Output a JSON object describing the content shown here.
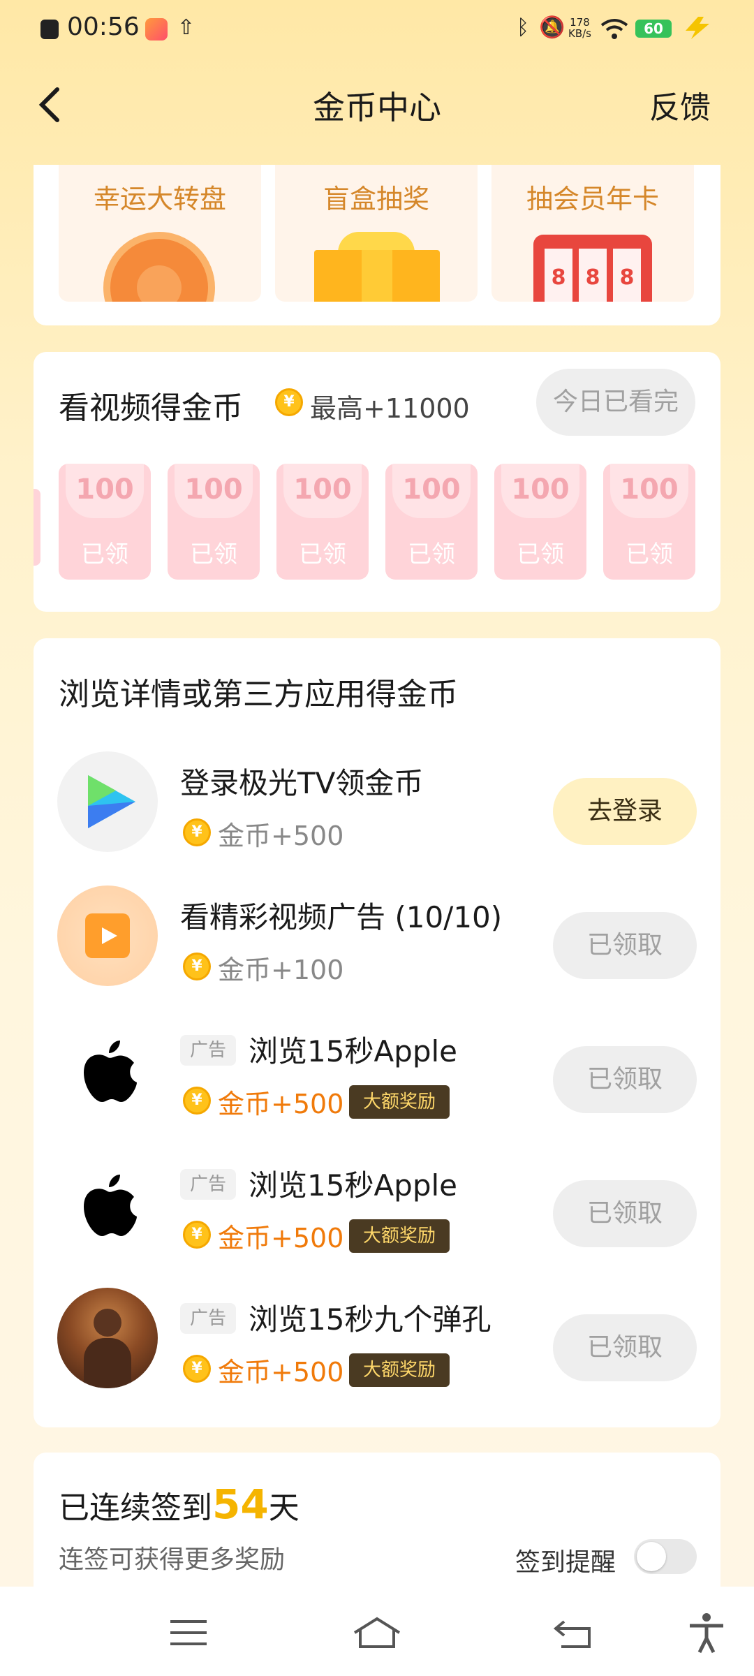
{
  "status_bar": {
    "time": "00:56",
    "speed_value": "178",
    "speed_unit": "KB/s",
    "battery": "60"
  },
  "nav": {
    "title": "金币中心",
    "feedback": "反馈"
  },
  "lottery": [
    {
      "label": "幸运大转盘",
      "icon": "wheel-icon"
    },
    {
      "label": "盲盒抽奖",
      "icon": "gift-box-icon"
    },
    {
      "label": "抽会员年卡",
      "icon": "slot-machine-icon",
      "digits": [
        "8",
        "8",
        "8"
      ]
    }
  ],
  "video": {
    "title": "看视频得金币",
    "max": "最高+11000",
    "button": "今日已看完",
    "envelopes": [
      {
        "amount": "100",
        "status": "已领"
      },
      {
        "amount": "100",
        "status": "已领"
      },
      {
        "amount": "100",
        "status": "已领"
      },
      {
        "amount": "100",
        "status": "已领"
      },
      {
        "amount": "100",
        "status": "已领"
      },
      {
        "amount": "100",
        "status": "已领"
      }
    ]
  },
  "tasks": {
    "header": "浏览详情或第三方应用得金币",
    "coin_symbol": "¥",
    "items": [
      {
        "title": "登录极光TV领金币",
        "reward": "金币+500",
        "button": "去登录"
      },
      {
        "title": "看精彩视频广告 (10/10)",
        "reward": "金币+100",
        "button": "已领取"
      },
      {
        "ad": "广告",
        "title": "浏览15秒Apple",
        "reward": "金币+500",
        "badge": "大额奖励",
        "button": "已领取"
      },
      {
        "ad": "广告",
        "title": "浏览15秒Apple",
        "reward": "金币+500",
        "badge": "大额奖励",
        "button": "已领取"
      },
      {
        "ad": "广告",
        "title": "浏览15秒九个弹孔",
        "reward": "金币+500",
        "badge": "大额奖励",
        "button": "已领取"
      }
    ]
  },
  "checkin": {
    "prefix": "已连续签到",
    "days": "54",
    "suffix": "天",
    "subtitle": "连签可获得更多奖励",
    "reminder": "签到提醒"
  }
}
